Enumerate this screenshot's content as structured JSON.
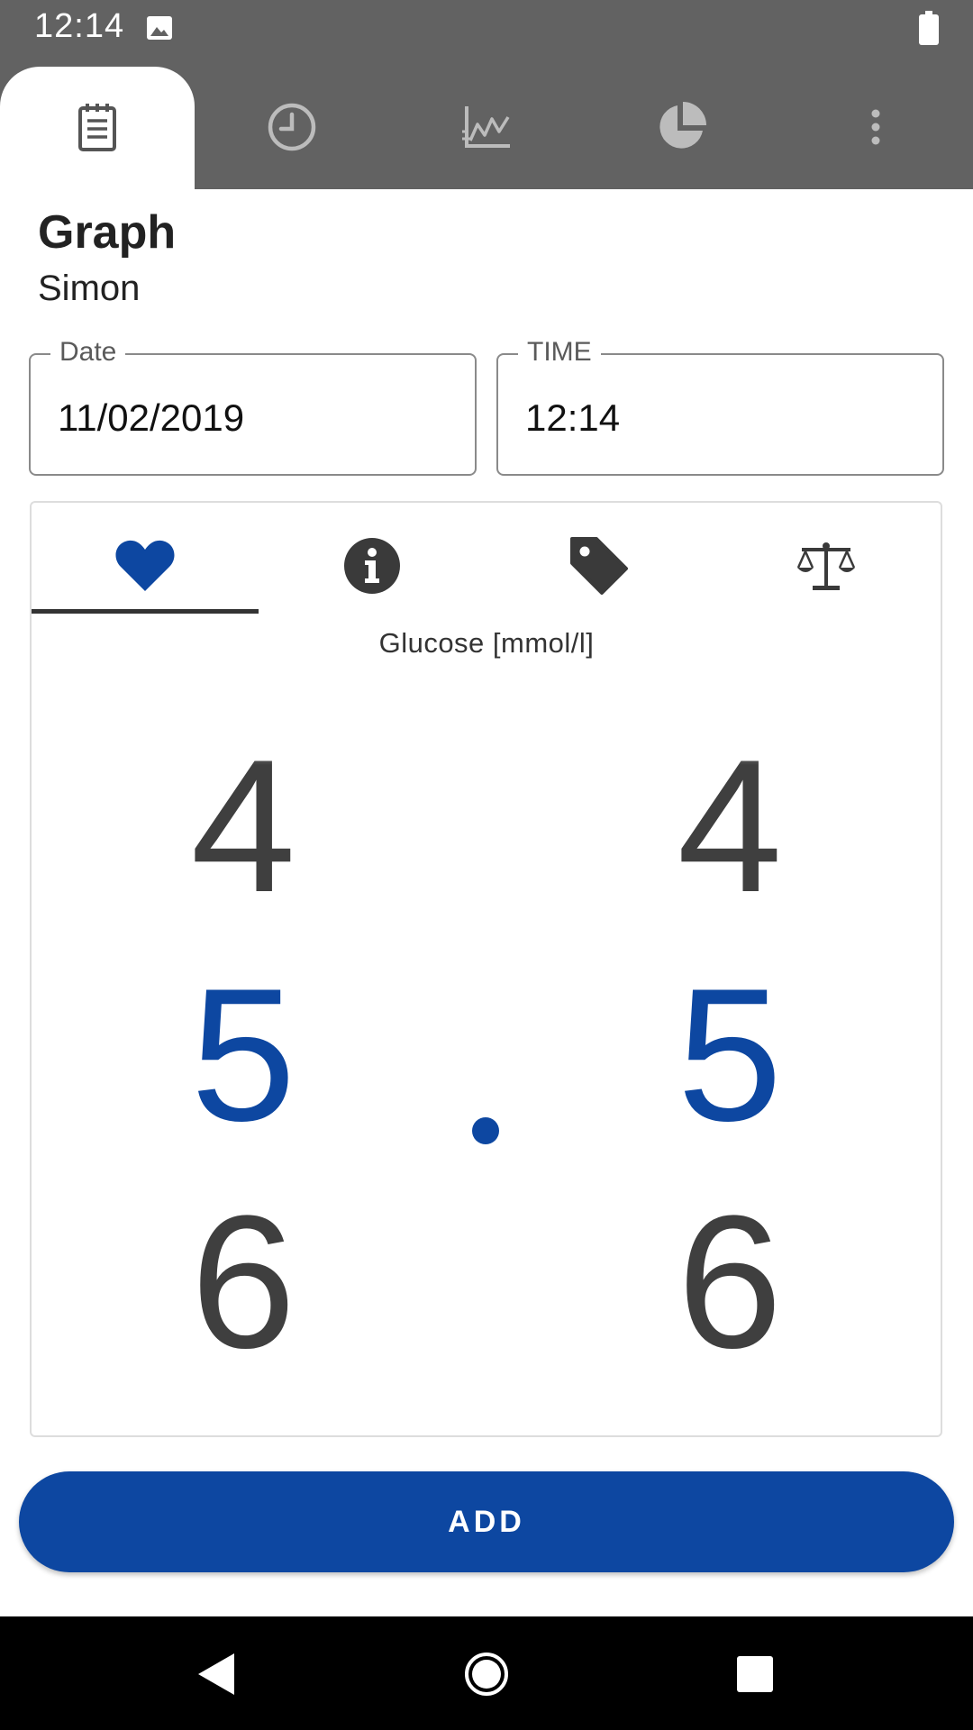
{
  "status_bar": {
    "time": "12:14"
  },
  "top_tabs": [
    {
      "name": "logbook",
      "icon": "notepad-icon",
      "active": true
    },
    {
      "name": "timeline",
      "icon": "clock-icon",
      "active": false
    },
    {
      "name": "graph",
      "icon": "line-chart-icon",
      "active": false
    },
    {
      "name": "statistics",
      "icon": "pie-chart-icon",
      "active": false
    },
    {
      "name": "more",
      "icon": "more-vert-icon",
      "active": false
    }
  ],
  "header": {
    "title": "Graph",
    "subtitle": "Simon"
  },
  "date_field": {
    "label": "Date",
    "value": "11/02/2019"
  },
  "time_field": {
    "label": "TIME",
    "value": "12:14"
  },
  "measurement_tabs": [
    {
      "icon": "heart-icon",
      "active": true
    },
    {
      "icon": "info-icon",
      "active": false
    },
    {
      "icon": "tag-icon",
      "active": false
    },
    {
      "icon": "scale-icon",
      "active": false
    }
  ],
  "glucose": {
    "label": "Glucose [mmol/l]",
    "integer_picker": {
      "prev": "4",
      "selected": "5",
      "next": "6"
    },
    "decimal_picker": {
      "prev": "4",
      "selected": "5",
      "next": "6"
    },
    "decimal_separator": "."
  },
  "add_button": {
    "label": "ADD"
  },
  "colors": {
    "accent": "#0d47a1",
    "topbar": "#626262",
    "text": "#3f3f3f"
  }
}
